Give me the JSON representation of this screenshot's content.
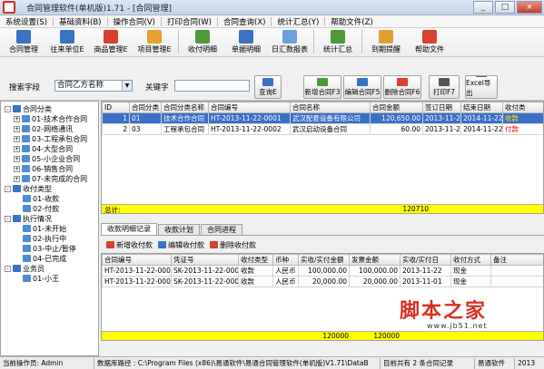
{
  "window": {
    "title": "合同管理软件(单机版)1.71 - [合同管理]",
    "minimize": "_",
    "maximize": "□",
    "close": "×"
  },
  "menu": [
    "系统设置(S)",
    "基础资料(B)",
    "操作合同(V)",
    "打印合同(W)",
    "合同查询(X)",
    "统计汇总(Y)",
    "帮助文件(Z)"
  ],
  "toolbar": [
    {
      "label": "合同管理",
      "color": "#3a72c4"
    },
    {
      "label": "往来单位E",
      "color": "#3a72c4"
    },
    {
      "label": "商品管理E",
      "color": "#d84030"
    },
    {
      "label": "项目管理E",
      "color": "#e8a030"
    },
    {
      "label": "收付明细",
      "color": "#4c9a3c"
    },
    {
      "label": "单据明细",
      "color": "#3a72c4"
    },
    {
      "label": "日汇数报表",
      "color": "#6aa0dc"
    },
    {
      "label": "统计汇总",
      "color": "#4c9a3c"
    },
    {
      "label": "到期提醒",
      "color": "#e0a030"
    },
    {
      "label": "帮助文件",
      "color": "#d84030"
    }
  ],
  "search": {
    "field_label": "搜索字段",
    "field_value": "合同乙方名称",
    "keyword_label": "关键字",
    "keyword_value": "",
    "query_button": "查询E"
  },
  "actions": [
    {
      "label": "新增合同F3",
      "color": "#4c9a3c"
    },
    {
      "label": "编辑合同F5",
      "color": "#3a72c4"
    },
    {
      "label": "删除合同F6",
      "color": "#d84030"
    },
    {
      "label": "打印F7",
      "color": "#555555"
    },
    {
      "label": "Excel导出",
      "color": "#3a8a3a"
    }
  ],
  "tree": [
    {
      "label": "合同分类",
      "level": 0,
      "expander": "-"
    },
    {
      "label": "01-技术合作合同",
      "level": 1,
      "expander": "+"
    },
    {
      "label": "02-网络通讯",
      "level": 1,
      "expander": "+"
    },
    {
      "label": "03-工程承包合同",
      "level": 1,
      "expander": "+"
    },
    {
      "label": "04-大型合同",
      "level": 1,
      "expander": "+"
    },
    {
      "label": "05-小企业合同",
      "level": 1,
      "expander": "+"
    },
    {
      "label": "06-销售合同",
      "level": 1,
      "expander": "+"
    },
    {
      "label": "07-未完成的合同",
      "level": 1,
      "expander": "+"
    },
    {
      "label": "收付类型",
      "level": 0,
      "expander": "-"
    },
    {
      "label": "01-收款",
      "level": 1,
      "expander": ""
    },
    {
      "label": "02-付款",
      "level": 1,
      "expander": ""
    },
    {
      "label": "执行情况",
      "level": 0,
      "expander": "-"
    },
    {
      "label": "01-未开始",
      "level": 1,
      "expander": ""
    },
    {
      "label": "02-执行中",
      "level": 1,
      "expander": ""
    },
    {
      "label": "03-中止/暂停",
      "level": 1,
      "expander": ""
    },
    {
      "label": "04-已完成",
      "level": 1,
      "expander": ""
    },
    {
      "label": "业务员",
      "level": 0,
      "expander": "-"
    },
    {
      "label": "01-小王",
      "level": 1,
      "expander": ""
    }
  ],
  "contracts": {
    "columns": [
      "ID",
      "合同分类",
      "合同分类名称",
      "合同编号",
      "合同名称",
      "合同金额",
      "签订日期",
      "结束日期",
      "收付类"
    ],
    "rows": [
      {
        "id": "1",
        "cat": "01",
        "cat_name": "技术合作合同",
        "no": "HT-2013-11-22-0001",
        "name": "武汉配套设备有限公司",
        "amount": "120,650.00",
        "sign": "2013-11-22",
        "end": "2014-11-22",
        "type": "收款",
        "selected": true
      },
      {
        "id": "2",
        "cat": "03",
        "cat_name": "工程承包合同",
        "no": "HT-2013-11-22-0002",
        "name": "武汉启动设备合同",
        "amount": "60.00",
        "sign": "2013-11-22",
        "end": "2014-11-22",
        "type": "付款",
        "selected": false
      }
    ],
    "total_label": "总计:",
    "total_value": "120710"
  },
  "tabs": [
    "收款明细记录",
    "收款计划",
    "合同进程"
  ],
  "sub_actions": [
    {
      "label": "新增收付款",
      "color": "#d84030"
    },
    {
      "label": "编辑收付款",
      "color": "#3a72c4"
    },
    {
      "label": "删除收付款",
      "color": "#d84030"
    }
  ],
  "payments": {
    "columns": [
      "合同编号",
      "凭证号",
      "收付类型",
      "币种",
      "实收/实付金额",
      "发票金额",
      "实收/实付日",
      "收付方式",
      "备注"
    ],
    "rows": [
      {
        "contract": "HT-2013-11-22-0001",
        "voucher": "SK-2013-11-22-0001",
        "type": "收款",
        "currency": "人民币",
        "amount": "100,000.00",
        "invoice": "100,000.00",
        "date": "2013-11-22",
        "method": "现金",
        "note": ""
      },
      {
        "contract": "HT-2013-11-22-0001",
        "voucher": "SK-2013-11-22-0002",
        "type": "收款",
        "currency": "人民币",
        "amount": "20,000.00",
        "invoice": "20,000.00",
        "date": "2013-11-01",
        "method": "现金",
        "note": ""
      }
    ],
    "total_amount": "120000",
    "total_invoice": "120000"
  },
  "status": {
    "operator": "当前操作员: Admin",
    "db_path": "数据库路径 : C:\\Program Files (x86)\\易通软件\\易通合同管理软件(单机版)V1.71\\DataB",
    "count": "目前共有 2 条合同记录",
    "company": "易通软件",
    "date": "2013"
  },
  "watermark": {
    "main": "脚本之家",
    "sub": "www.jb51.net"
  }
}
